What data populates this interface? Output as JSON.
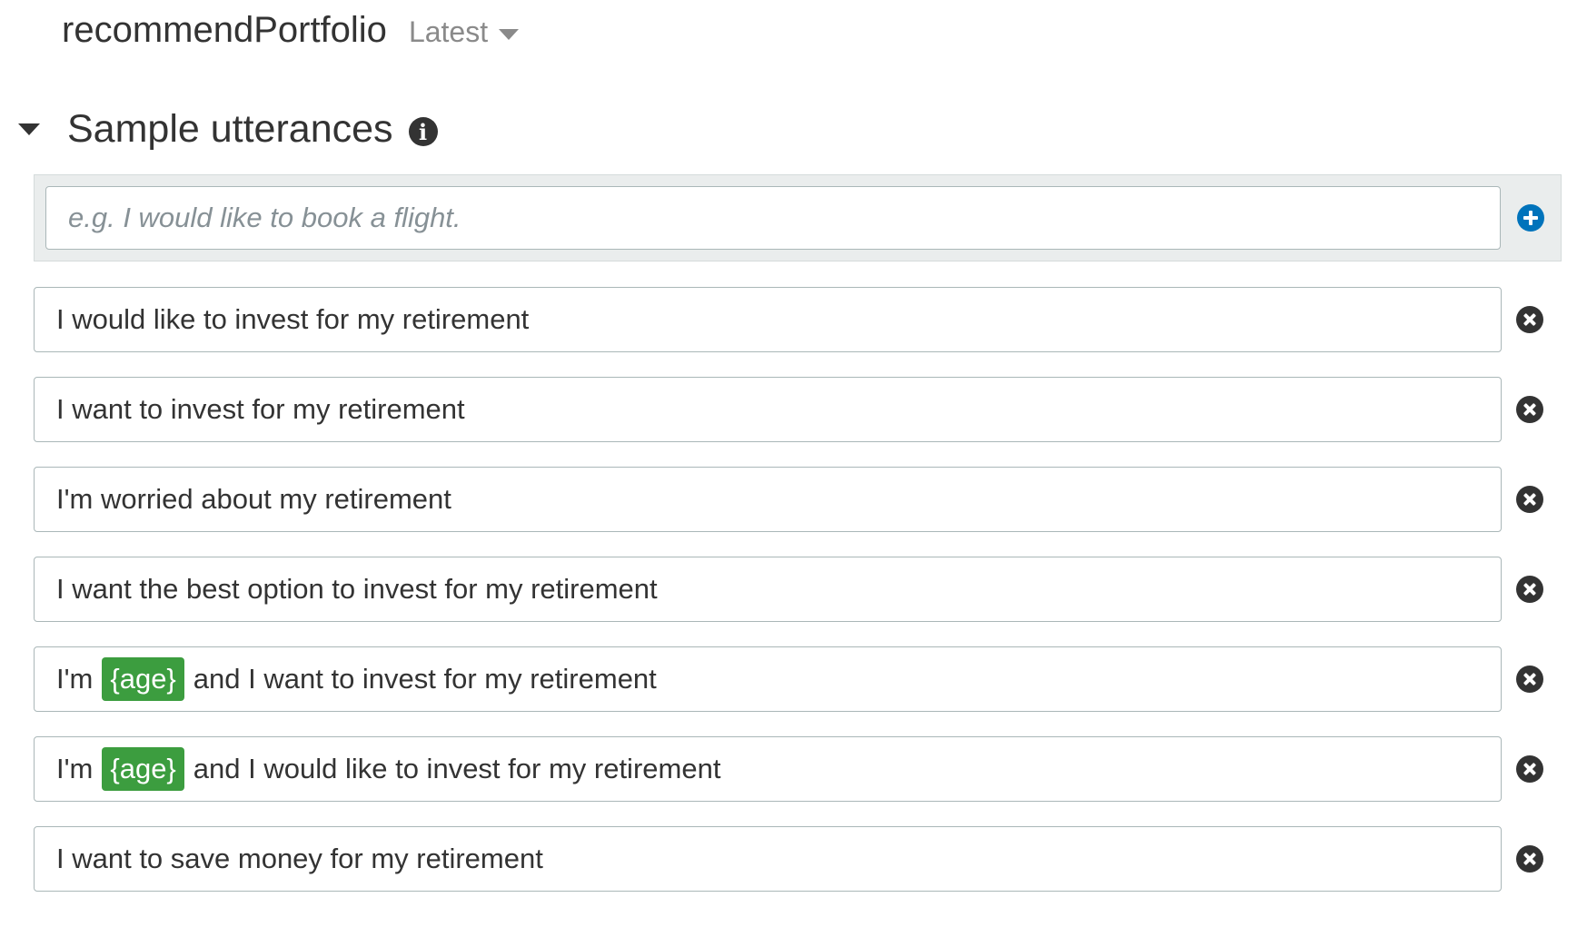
{
  "header": {
    "intent_name": "recommendPortfolio",
    "version_label": "Latest"
  },
  "section": {
    "title": "Sample utterances",
    "info_icon": "info-icon",
    "collapse_icon": "caret-down-icon"
  },
  "new_utterance": {
    "placeholder": "e.g. I would like to book a flight.",
    "value": "",
    "add_icon": "plus-circle-icon"
  },
  "utterances": [
    {
      "parts": [
        {
          "type": "text",
          "text": "I would like to invest for my retirement"
        }
      ]
    },
    {
      "parts": [
        {
          "type": "text",
          "text": "I want to invest for my retirement"
        }
      ]
    },
    {
      "parts": [
        {
          "type": "text",
          "text": "I'm worried about my retirement"
        }
      ]
    },
    {
      "parts": [
        {
          "type": "text",
          "text": "I want the best option to invest for my retirement"
        }
      ]
    },
    {
      "parts": [
        {
          "type": "text",
          "text": "I'm"
        },
        {
          "type": "slot",
          "text": "{age}"
        },
        {
          "type": "text",
          "text": "and I want to invest for my retirement"
        }
      ]
    },
    {
      "parts": [
        {
          "type": "text",
          "text": "I'm"
        },
        {
          "type": "slot",
          "text": "{age}"
        },
        {
          "type": "text",
          "text": "and I would like to invest for my retirement"
        }
      ]
    },
    {
      "parts": [
        {
          "type": "text",
          "text": "I want to save money for my retirement"
        }
      ]
    }
  ],
  "colors": {
    "slot_background": "#3c9d3f",
    "add_button": "#0073bb",
    "delete_button": "#333333"
  },
  "delete_icon": "close-circle-icon"
}
